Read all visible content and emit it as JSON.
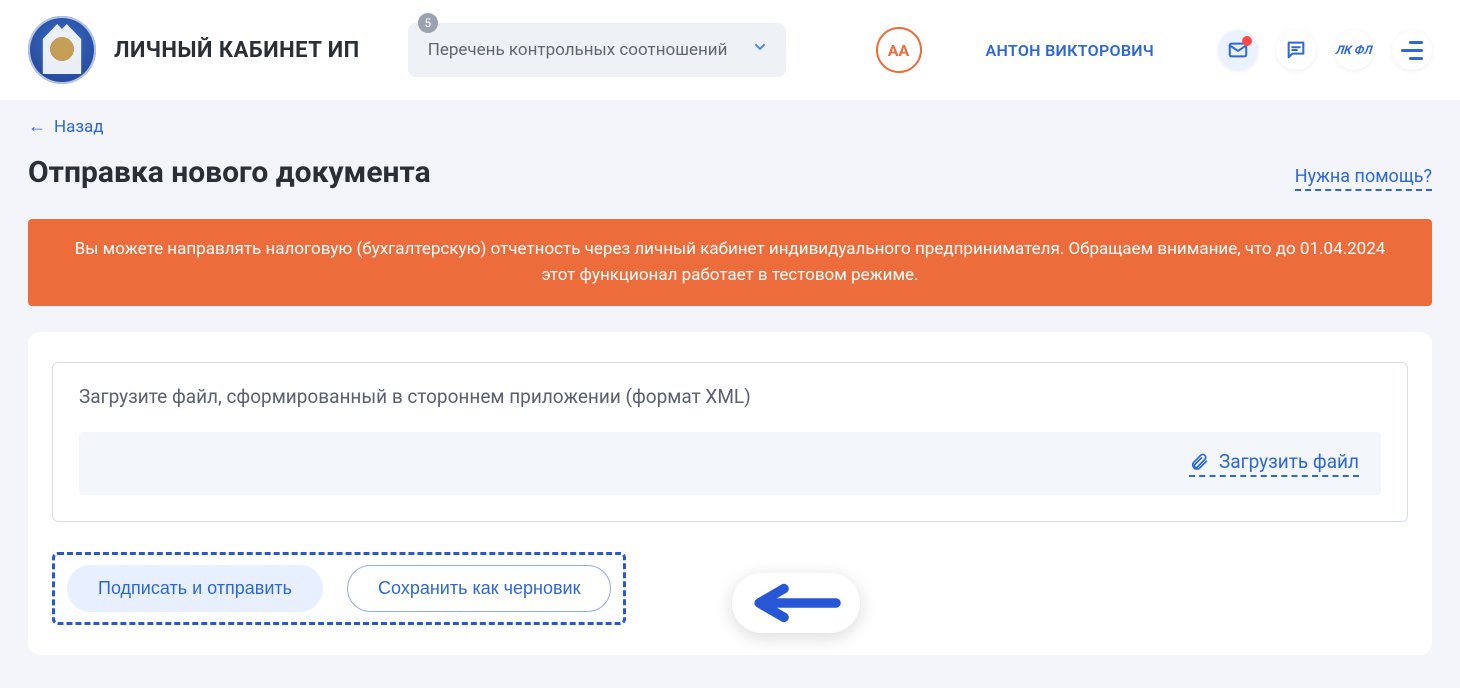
{
  "header": {
    "site_title": "ЛИЧНЫЙ КАБИНЕТ ИП",
    "dropdown": {
      "label": "Перечень контрольных соотношений",
      "badge": "5"
    },
    "avatar": "AA",
    "user_name": "АНТОН ВИКТОРОВИЧ",
    "lkfl": "ЛК ФЛ"
  },
  "nav": {
    "back": "Назад"
  },
  "page": {
    "title": "Отправка нового документа",
    "help": "Нужна помощь?"
  },
  "alert": {
    "text": "Вы можете направлять налоговую (бухгалтерскую) отчетность через личный кабинет индивидуального предпринимателя. Обращаем внимание, что до 01.04.2024 этот функционал работает в тестовом режиме."
  },
  "upload": {
    "title": "Загрузите файл, сформированный в стороннем приложении (формат XML)",
    "link": "Загрузить файл"
  },
  "actions": {
    "sign_send": "Подписать и отправить",
    "save_draft": "Сохранить как черновик"
  }
}
